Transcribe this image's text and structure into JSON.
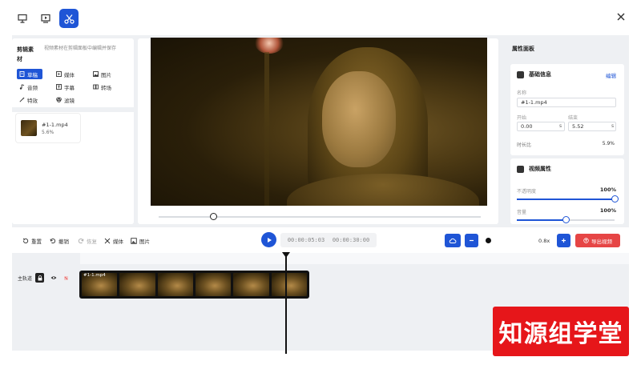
{
  "colors": {
    "accent": "#1f55d6",
    "export": "#e64545",
    "watermark": "#e6161a"
  },
  "topbar": {
    "modes": [
      {
        "icon": "presentation-icon"
      },
      {
        "icon": "monitor-play-icon"
      },
      {
        "icon": "scissors-icon",
        "active": true
      }
    ],
    "close_icon": "close-icon"
  },
  "left_panel": {
    "title": "剪辑素材",
    "hint": "视频素材在剪辑面板中编辑并保存",
    "tabs": [
      {
        "label": "草稿",
        "icon": "file-icon",
        "active": true
      },
      {
        "label": "媒体",
        "icon": "media-icon"
      },
      {
        "label": "图片",
        "icon": "image-icon"
      },
      {
        "label": "音频",
        "icon": "music-icon"
      },
      {
        "label": "字幕",
        "icon": "text-icon"
      },
      {
        "label": "转场",
        "icon": "transition-icon"
      },
      {
        "label": "特效",
        "icon": "magic-wand-icon"
      },
      {
        "label": "滤镜",
        "icon": "filter-icon"
      }
    ],
    "asset": {
      "name": "#1-1.mp4",
      "size": "5.6%"
    }
  },
  "preview": {
    "progress": 0.17
  },
  "properties": {
    "title": "属性面板",
    "basic": {
      "title": "基础信息",
      "link": "编辑",
      "name_label": "名称",
      "name_value": "#1-1.mp4",
      "start_label": "开始",
      "start_value": "0.00",
      "start_unit": "s",
      "end_label": "结束",
      "end_value": "5.52",
      "end_unit": "s",
      "duration_label": "时长比",
      "duration_value": "5.9%"
    },
    "video": {
      "title": "视频属性",
      "opacity_label": "不透明度",
      "opacity_value": "100%",
      "opacity": 1.0,
      "volume_label": "音量",
      "volume_value": "100%",
      "volume": 0.5
    }
  },
  "toolbar": {
    "undo": "重置",
    "redo": "撤销",
    "redo2": "恢复",
    "split": "媒体",
    "delete": "图片",
    "current_time": "00:00:05:03",
    "total_time": "00:00:30:00",
    "zoom": "0.8x",
    "export": "导出视频"
  },
  "timeline": {
    "track_label": "主轨道",
    "clip_name": "#1-1.mp4",
    "frame_count": 6
  },
  "watermark": "知源组学堂"
}
